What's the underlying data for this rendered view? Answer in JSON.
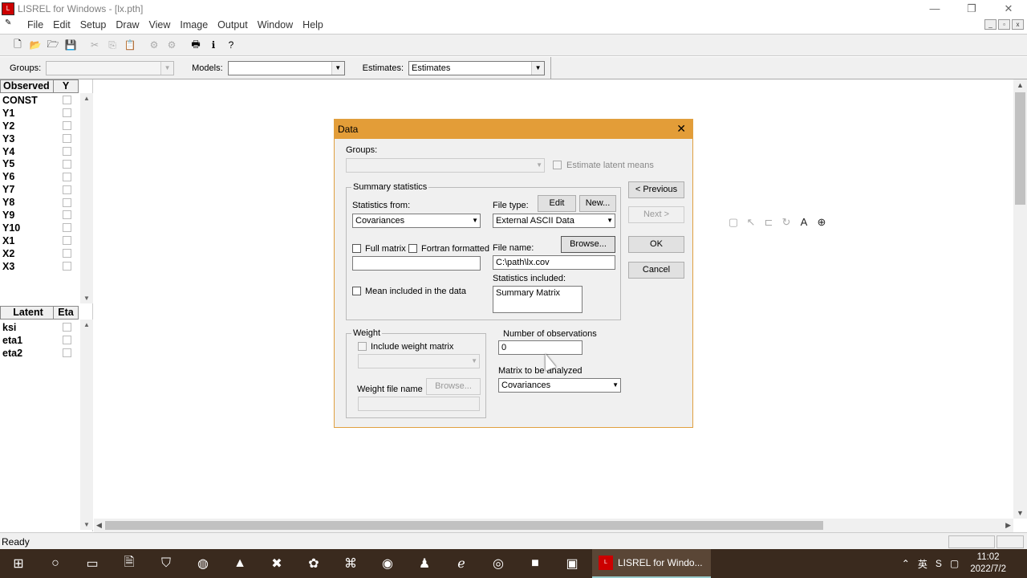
{
  "window": {
    "title": "LISREL for Windows - [lx.pth]",
    "minimize": "—",
    "restore": "❐",
    "close": "✕"
  },
  "menu": [
    "File",
    "Edit",
    "Setup",
    "Draw",
    "View",
    "Image",
    "Output",
    "Window",
    "Help"
  ],
  "selectors": {
    "groups_label": "Groups:",
    "groups_value": "",
    "models_label": "Models:",
    "models_value": "",
    "estimates_label": "Estimates:",
    "estimates_value": "Estimates"
  },
  "observed": {
    "header": "Observed",
    "col": "Y",
    "vars": [
      "CONST",
      "Y1",
      "Y2",
      "Y3",
      "Y4",
      "Y5",
      "Y6",
      "Y7",
      "Y8",
      "Y9",
      "Y10",
      "X1",
      "X2",
      "X3"
    ]
  },
  "latent": {
    "header": "Latent",
    "col": "Eta",
    "vars": [
      "ksi",
      "eta1",
      "eta2"
    ]
  },
  "status": {
    "text": "Ready"
  },
  "dialog": {
    "title": "Data",
    "close": "✕",
    "groups_label": "Groups:",
    "estimate_latent_means": "Estimate latent means",
    "summary_title": "Summary statistics",
    "statistics_from_label": "Statistics from:",
    "statistics_from_value": "Covariances",
    "file_type_label": "File type:",
    "file_type_value": "External ASCII Data",
    "edit_button": "Edit",
    "new_button": "New...",
    "full_matrix": "Full matrix",
    "fortran_formatted": "Fortran formatted",
    "file_name_label": "File name:",
    "browse_button": "Browse...",
    "file_name_value": "C:\\path\\lx.cov",
    "statistics_included_label": "Statistics included:",
    "statistics_included_value": "Summary Matrix",
    "mean_included": "Mean included in the data",
    "weight_title": "Weight",
    "include_weight_matrix": "Include weight matrix",
    "weight_file_name_label": "Weight file name",
    "weight_browse_button": "Browse...",
    "num_obs_label": "Number of observations",
    "num_obs_value": "0",
    "matrix_label": "Matrix to be analyzed",
    "matrix_value": "Covariances",
    "previous_button": "< Previous",
    "next_button": "Next >",
    "ok_button": "OK",
    "cancel_button": "Cancel"
  },
  "taskbar": {
    "active_app": "LISREL for Windo...",
    "ime": "英",
    "time": "11:02",
    "date": "2022/7/2"
  }
}
